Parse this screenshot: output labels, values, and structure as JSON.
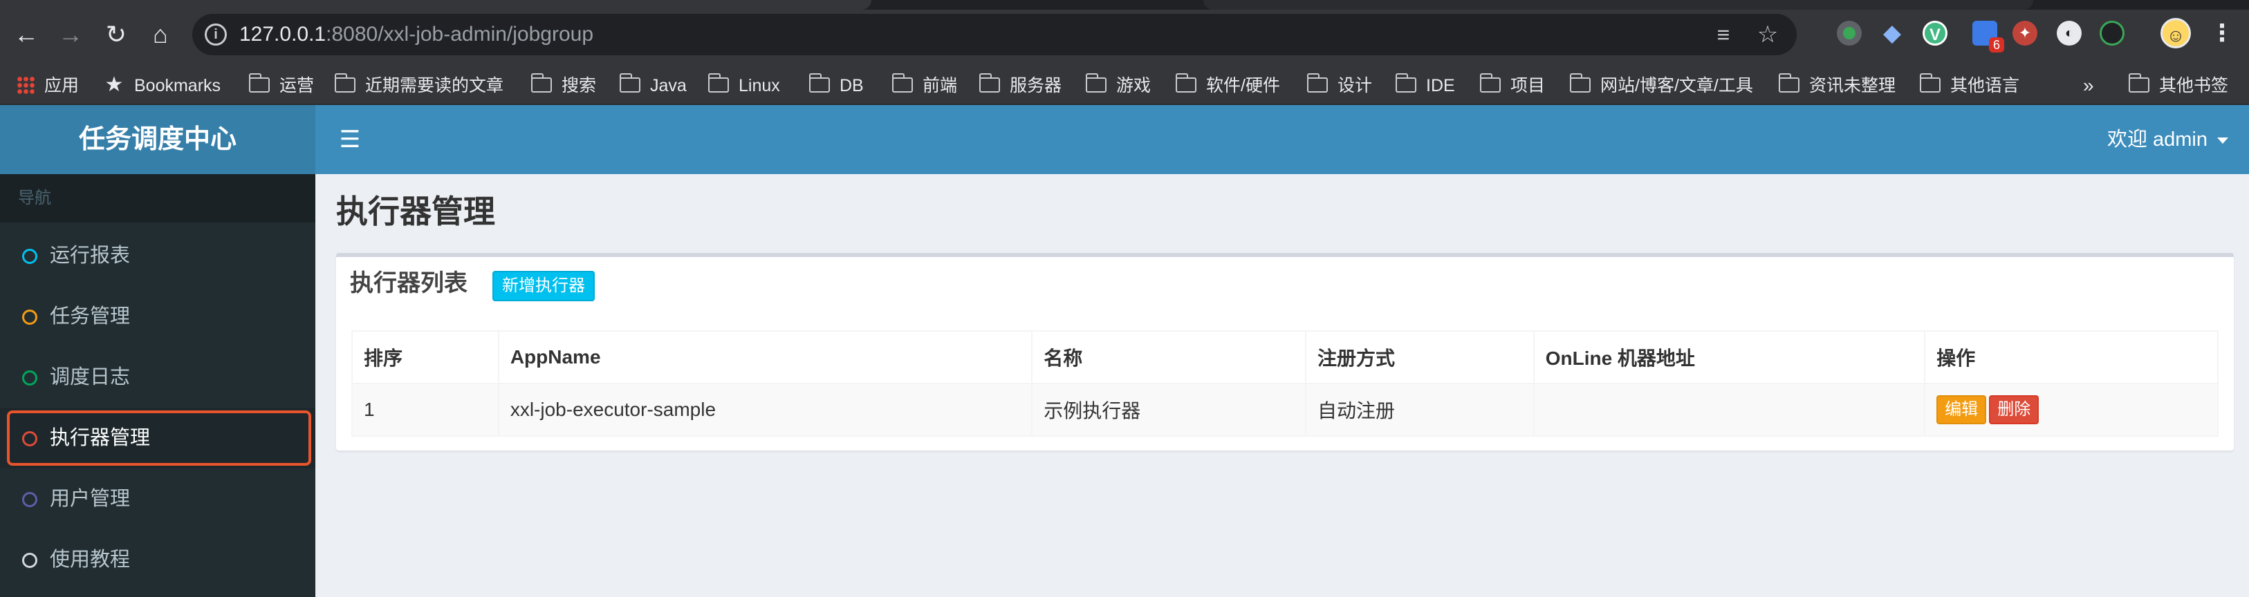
{
  "browser": {
    "url_host": "127.0.0.1",
    "url_rest": ":8080/xxl-job-admin/jobgroup",
    "extension_badge": "6",
    "bookmarks_overflow": "»",
    "bookmarks": [
      {
        "label": "应用",
        "icon": "apps-grid-icon"
      },
      {
        "label": "Bookmarks",
        "icon": "star-icon"
      },
      {
        "label": "运营",
        "icon": "folder-icon"
      },
      {
        "label": "近期需要读的文章",
        "icon": "folder-icon"
      },
      {
        "label": "搜索",
        "icon": "folder-icon"
      },
      {
        "label": "Java",
        "icon": "folder-icon"
      },
      {
        "label": "Linux",
        "icon": "folder-icon"
      },
      {
        "label": "DB",
        "icon": "folder-icon"
      },
      {
        "label": "前端",
        "icon": "folder-icon"
      },
      {
        "label": "服务器",
        "icon": "folder-icon"
      },
      {
        "label": "游戏",
        "icon": "folder-icon"
      },
      {
        "label": "软件/硬件",
        "icon": "folder-icon"
      },
      {
        "label": "设计",
        "icon": "folder-icon"
      },
      {
        "label": "IDE",
        "icon": "folder-icon"
      },
      {
        "label": "项目",
        "icon": "folder-icon"
      },
      {
        "label": "网站/博客/文章/工具",
        "icon": "folder-icon"
      },
      {
        "label": "资讯未整理",
        "icon": "folder-icon"
      },
      {
        "label": "其他语言",
        "icon": "folder-icon"
      },
      {
        "label": "其他书签",
        "icon": "folder-icon"
      }
    ]
  },
  "app": {
    "logo": "任务调度中心",
    "user_menu": "欢迎 admin"
  },
  "sidebar": {
    "header": "导航",
    "items": [
      {
        "label": "运行报表",
        "color": "#00c0ef"
      },
      {
        "label": "任务管理",
        "color": "#f39c12"
      },
      {
        "label": "调度日志",
        "color": "#00a65a"
      },
      {
        "label": "执行器管理",
        "color": "#dd4b39",
        "active": true
      },
      {
        "label": "用户管理",
        "color": "#605ca8"
      },
      {
        "label": "使用教程",
        "color": "#d2d6de"
      }
    ]
  },
  "main": {
    "page_title": "执行器管理",
    "box_title": "执行器列表",
    "add_button": "新增执行器",
    "table": {
      "columns": [
        "排序",
        "AppName",
        "名称",
        "注册方式",
        "OnLine 机器地址",
        "操作"
      ],
      "rows": [
        {
          "order": "1",
          "appname": "xxl-job-executor-sample",
          "name": "示例执行器",
          "register": "自动注册",
          "online": "",
          "edit": "编辑",
          "delete": "删除"
        }
      ]
    }
  }
}
